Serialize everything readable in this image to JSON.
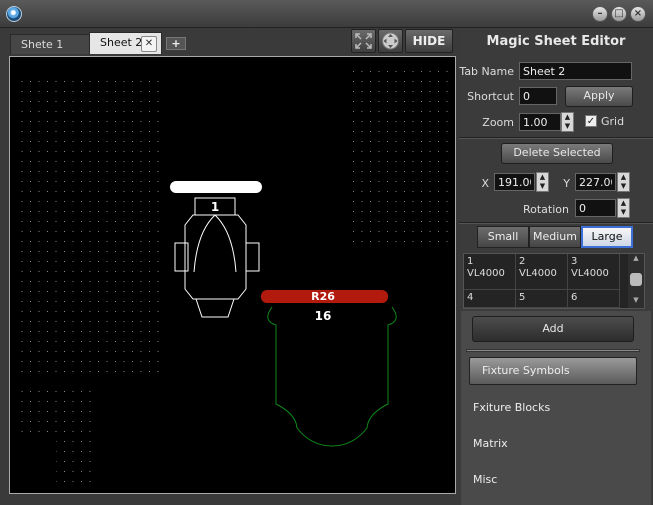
{
  "tabs": [
    {
      "label": "Shete 1"
    },
    {
      "label": "Sheet 2"
    }
  ],
  "toolbar": {
    "add_tab": "+",
    "hide": "HIDE"
  },
  "panel": {
    "title": "Magic Sheet Editor",
    "tab_name_label": "Tab Name",
    "tab_name_value": "Sheet 2",
    "shortcut_label": "Shortcut",
    "shortcut_value": "0",
    "apply": "Apply",
    "zoom_label": "Zoom",
    "zoom_value": "1.00",
    "grid_label": "Grid",
    "grid_checked": true,
    "delete_selected": "Delete Selected",
    "x_label": "X",
    "x_value": "191.00",
    "y_label": "Y",
    "y_value": "227.00",
    "rotation_label": "Rotation",
    "rotation_value": "0",
    "sizes": [
      "Small",
      "Medium",
      "Large"
    ],
    "size_selected": "Large",
    "fixtures": [
      {
        "num": "1",
        "type": "VL4000"
      },
      {
        "num": "2",
        "type": "VL4000"
      },
      {
        "num": "3",
        "type": "VL4000"
      },
      {
        "num": "4",
        "type": ""
      },
      {
        "num": "5",
        "type": ""
      },
      {
        "num": "6",
        "type": ""
      }
    ],
    "add": "Add",
    "categories": [
      "Fixture Symbols",
      "Fxiture Blocks",
      "Matrix",
      "Misc"
    ]
  },
  "canvas_items": {
    "fixture_1_number": "1",
    "fixture_2_gel": "R26",
    "fixture_2_number": "16"
  },
  "colors": {
    "gel_red": "#b31a0e",
    "outline_green": "#0f8a1a",
    "selection_blue": "#3d6fd6"
  }
}
